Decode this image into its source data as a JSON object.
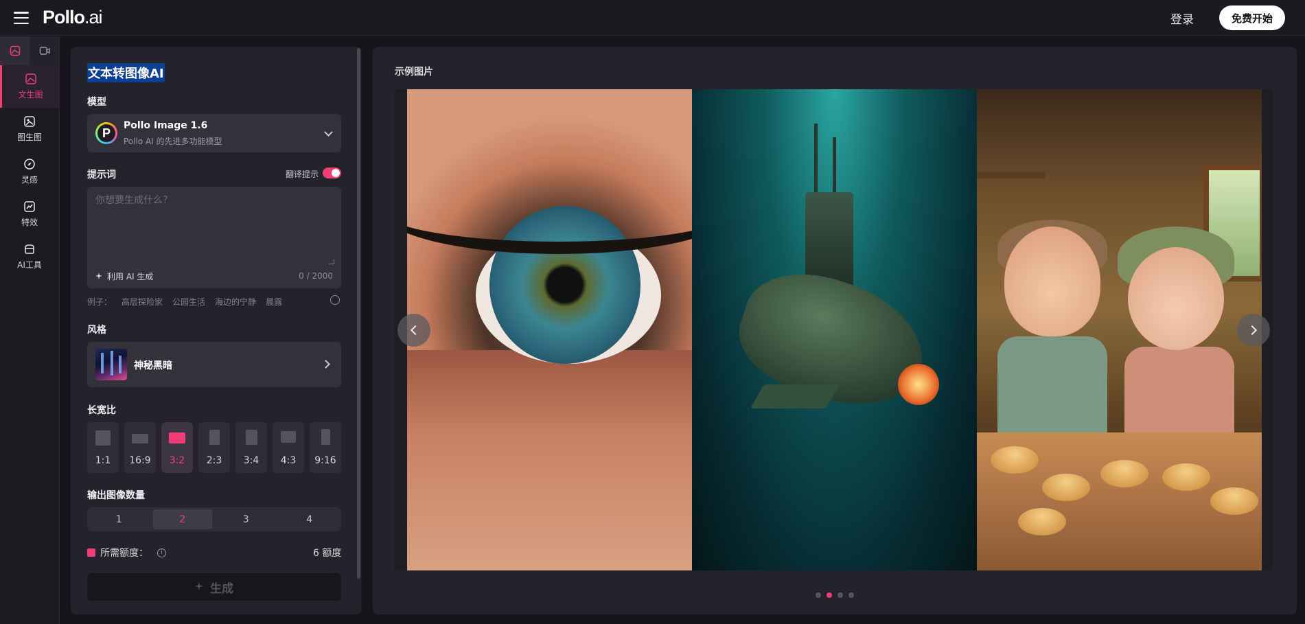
{
  "header": {
    "logo_main": "Pollo",
    "logo_suffix": ".ai",
    "login_label": "登录",
    "start_label": "免费开始"
  },
  "sidebar": {
    "items": [
      {
        "label": "文生图",
        "icon": "image-gen-icon",
        "active": true
      },
      {
        "label": "图生图",
        "icon": "image-to-image-icon"
      },
      {
        "label": "灵感",
        "icon": "compass-icon"
      },
      {
        "label": "特效",
        "icon": "effects-icon"
      },
      {
        "label": "AI工具",
        "icon": "toolbox-icon"
      }
    ]
  },
  "form": {
    "heading": "文本转图像AI",
    "model_label": "模型",
    "model_name": "Pollo Image 1.6",
    "model_desc": "Pollo AI 的先进多功能模型",
    "model_logo_letter": "P",
    "prompt_label": "提示词",
    "translate_label": "翻译提示",
    "translate_on": true,
    "prompt_placeholder": "你想要生成什么？",
    "prompt_value": "",
    "ai_generate_label": "利用 AI 生成",
    "counter": "0 / 2000",
    "examples_label": "例子：",
    "examples": [
      "高层探险家",
      "公园生活",
      "海边的宁静",
      "晨露"
    ],
    "style_label": "风格",
    "style_name": "神秘黑暗",
    "ratio_label": "长宽比",
    "ratios": [
      "1:1",
      "16:9",
      "3:2",
      "2:3",
      "3:4",
      "4:3",
      "9:16"
    ],
    "ratio_selected": "3:2",
    "count_label": "输出图像数量",
    "counts": [
      "1",
      "2",
      "3",
      "4"
    ],
    "count_selected": "2",
    "credit_label": "所需额度：",
    "credit_value": "6 额度",
    "generate_label": "生成"
  },
  "showcase": {
    "title": "示例图片",
    "slides_total": 4,
    "slide_active": 2
  },
  "colors": {
    "accent": "#f23e74",
    "background": "#16151c",
    "panel": "#24232b",
    "selection": "#0b3f94"
  }
}
